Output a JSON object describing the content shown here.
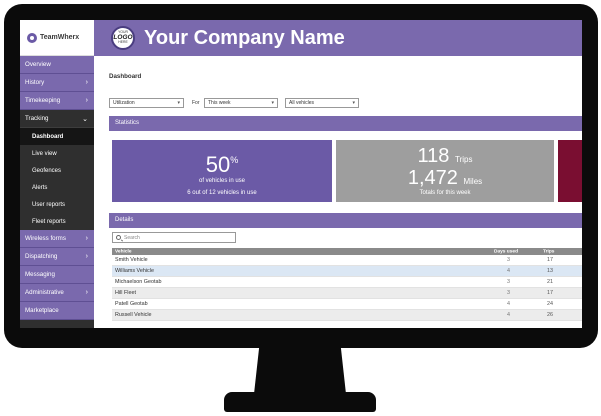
{
  "brand": {
    "name": "TeamWherx"
  },
  "header": {
    "company_name": "Your Company Name",
    "logo_top": "YOUR",
    "logo_main": "LOGO",
    "logo_bottom": "HERE"
  },
  "sidebar": {
    "items": [
      {
        "label": "Overview",
        "chevron": ""
      },
      {
        "label": "History",
        "chevron": ">"
      },
      {
        "label": "Timekeeping",
        "chevron": ">"
      },
      {
        "label": "Tracking",
        "chevron": "v"
      }
    ],
    "tracking_sub": [
      {
        "label": "Dashboard"
      },
      {
        "label": "Live view"
      },
      {
        "label": "Geofences"
      },
      {
        "label": "Alerts"
      },
      {
        "label": "User reports"
      },
      {
        "label": "Fleet reports"
      }
    ],
    "items_after": [
      {
        "label": "Wireless forms",
        "chevron": ">"
      },
      {
        "label": "Dispatching",
        "chevron": ">"
      },
      {
        "label": "Messaging",
        "chevron": ""
      },
      {
        "label": "Administrative",
        "chevron": ">"
      },
      {
        "label": "Marketplace",
        "chevron": ""
      }
    ]
  },
  "dashboard": {
    "title": "Dashboard",
    "metric_select": "Utilization",
    "for_label": "For",
    "period_select": "This week",
    "vehicle_select": "All vehicles"
  },
  "statistics": {
    "title": "Statistics",
    "utilization_value": "50",
    "utilization_unit": "%",
    "utilization_caption": "of vehicles in use",
    "utilization_detail": "6 out of 12 vehicles in use",
    "trips_value": "118",
    "trips_unit": "Trips",
    "miles_value": "1,472",
    "miles_unit": "Miles",
    "totals_caption": "Totals for this week"
  },
  "details": {
    "title": "Details",
    "search_placeholder": "Search",
    "columns": {
      "vehicle": "Vehicle",
      "days_used": "Days used",
      "trips": "Trips"
    },
    "rows": [
      {
        "vehicle": "Smith Vehicle",
        "days": "3",
        "trips": "17"
      },
      {
        "vehicle": "Williams Vehicle",
        "days": "4",
        "trips": "13"
      },
      {
        "vehicle": "Michaelson Geotab",
        "days": "3",
        "trips": "21"
      },
      {
        "vehicle": "Hill Fleet",
        "days": "3",
        "trips": "17"
      },
      {
        "vehicle": "Patell Geotab",
        "days": "4",
        "trips": "24"
      },
      {
        "vehicle": "Russell Vehicle",
        "days": "4",
        "trips": "26"
      }
    ]
  },
  "colors": {
    "brand_purple": "#7a69ad",
    "card_purple": "#6b5aa6",
    "card_gray": "#9e9e9e",
    "card_maroon": "#7a0e31"
  }
}
